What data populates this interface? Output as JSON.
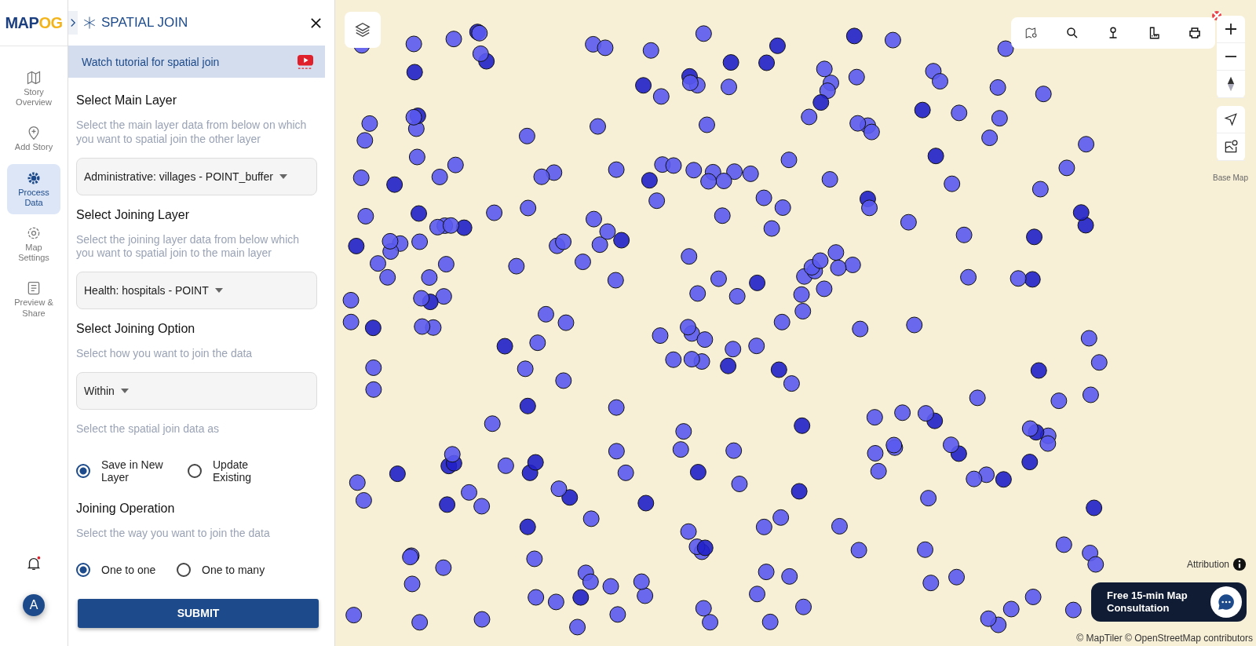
{
  "logo_parts": [
    "MAP",
    "OG"
  ],
  "nav": [
    {
      "label": "Story Overview",
      "kind": "map",
      "selected": false
    },
    {
      "label": "Add Story",
      "kind": "pin",
      "selected": false
    },
    {
      "label": "Process Data",
      "kind": "gear",
      "selected": true
    },
    {
      "label": "Map Settings",
      "kind": "cog",
      "selected": false
    },
    {
      "label": "Preview & Share",
      "kind": "doc",
      "selected": false
    }
  ],
  "notifications": {
    "unread": true
  },
  "avatar": "A",
  "panel": {
    "title": "SPATIAL JOIN",
    "tutorial": "Watch tutorial for spatial join",
    "sections": [
      {
        "kind": "dropdown",
        "heading": "Select Main Layer",
        "hint": "Select the main layer data from below on which you want to spatial join the other layer",
        "value": "Administrative: villages - POINT_buffer"
      },
      {
        "kind": "dropdown",
        "heading": "Select Joining Layer",
        "hint": "Select the joining layer data from below which you want to spatial join to the main layer",
        "value": "Health: hospitals - POINT"
      },
      {
        "kind": "dropdown",
        "heading": "Select Joining Option",
        "hint": "Select how you want to join the data",
        "value": "Within"
      },
      {
        "kind": "radios",
        "hint": "Select the spatial join data as",
        "options": [
          {
            "label": "Save in New Layer",
            "selected": true
          },
          {
            "label": "Update Existing",
            "selected": false
          }
        ]
      },
      {
        "kind": "radios",
        "heading": "Joining Operation",
        "hint": "Select the way you want to join the data",
        "options": [
          {
            "label": "One to one",
            "selected": true
          },
          {
            "label": "One to many",
            "selected": false
          }
        ]
      }
    ],
    "submit": "SUBMIT"
  },
  "map": {
    "base_map": "Base Map",
    "attribution": "Attribution",
    "credits": "© MapTiler © OpenStreetMap contributors",
    "consultation": "Free 15-min Map Consultation"
  }
}
